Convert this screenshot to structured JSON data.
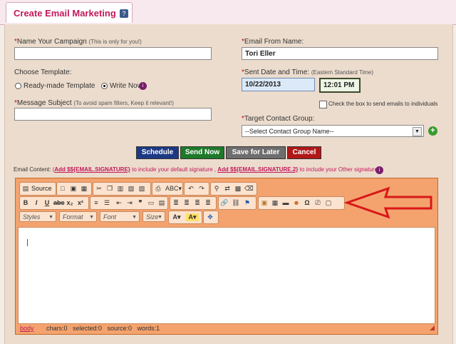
{
  "tab": {
    "title": "Create Email Marketing",
    "help_icon": "help-icon"
  },
  "campaign": {
    "label": "Name Your Campaign",
    "note": "(This is only for you!)",
    "value": ""
  },
  "template": {
    "label": "Choose Template:",
    "option_readymade": "Ready-made Template",
    "option_write": "Write Now",
    "selected": "Write Now"
  },
  "subject": {
    "label": "Message Subject",
    "note": "(To avoid spam filters, Keep it relevant!)",
    "value": ""
  },
  "from_name": {
    "label": "Email From Name:",
    "value": "Tori Eller"
  },
  "sent_date": {
    "label": "Sent Date and Time:",
    "note": "(Eastern Standard Time)",
    "date": "10/22/2013",
    "time": "12:01 PM"
  },
  "individuals": {
    "label": "Check the box to send emails to individuals",
    "checked": false
  },
  "target_group": {
    "label": "Target Contact Group:",
    "selected": "--Select Contact Group Name--"
  },
  "buttons": {
    "schedule": "Schedule",
    "send_now": "Send Now",
    "save_later": "Save for Later",
    "cancel": "Cancel"
  },
  "email_content": {
    "label": "Email Content:",
    "paren_open": "(",
    "sig1": "Add $${EMAIL.SIGNATURE}",
    "mid": " to include your default signature ,",
    "sig2": "Add $${EMAIL.SIGNATURE.2}",
    "end": " to include your Other signature)"
  },
  "editor": {
    "source_label": "Source",
    "combos": [
      "Styles",
      "Format",
      "Font",
      "Size"
    ],
    "status_path": "body",
    "status_counts": "chars:0   selected:0   source:0   words:1"
  },
  "colors": {
    "schedule": "#1c3a84",
    "send_now": "#1e7a2a",
    "save_later": "#6e6e6e",
    "cancel": "#b01818",
    "arrow": "#d81818",
    "accent": "#c2185b"
  }
}
